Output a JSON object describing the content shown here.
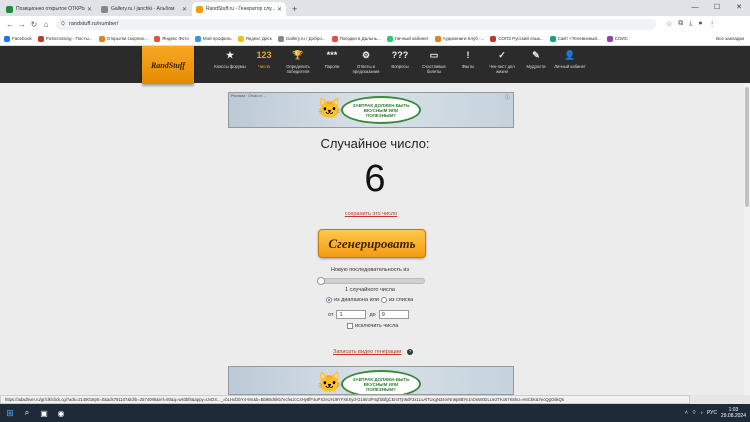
{
  "browser": {
    "tabs": [
      {
        "title": "Позиционно открытое ОТКРЫТИ",
        "color": "#1e8e3e",
        "active": false
      },
      {
        "title": "Gallery.ru / janchki - Альбом",
        "color": "#888888",
        "active": false
      },
      {
        "title": "RandStuff.ru - Генератор слу...",
        "color": "#f39c12",
        "active": true
      }
    ],
    "new_tab": "+",
    "url": "randstuff.ru/number/",
    "bookmarks": [
      {
        "label": "Facebook",
        "color": "#1877f2"
      },
      {
        "label": "Postcrossing - Посты...",
        "color": "#c0392b"
      },
      {
        "label": "Открытки скорпио...",
        "color": "#e67e22"
      },
      {
        "label": "Яндекс Фото",
        "color": "#e74c3c"
      },
      {
        "label": "Мой профиль",
        "color": "#3498db"
      },
      {
        "label": "Яндекс Диск",
        "color": "#f1c40f"
      },
      {
        "label": "Gallery.ru / Добро...",
        "color": "#888888"
      },
      {
        "label": "Поездки в Дальнь...",
        "color": "#e74c3c"
      },
      {
        "label": "Личный кабинет",
        "color": "#2ecc71"
      },
      {
        "label": "Аудиокниги Клуб -...",
        "color": "#e67e22"
      },
      {
        "label": "СОПЗ Русский язык...",
        "color": "#c0392b"
      },
      {
        "label": "Сайт «Телевизный...",
        "color": "#16a085"
      },
      {
        "label": "СОИС",
        "color": "#8e44ad"
      }
    ],
    "all_bookmarks": "Все закладки"
  },
  "site": {
    "logo": "RandStuff",
    "nav": [
      {
        "icon": "★",
        "label": "Классы форумы",
        "active": false
      },
      {
        "icon": "123",
        "label": "Числа",
        "active": true
      },
      {
        "icon": "🏆",
        "label": "Определить победителя",
        "active": false
      },
      {
        "icon": "***",
        "label": "Пароли",
        "active": false
      },
      {
        "icon": "⚙",
        "label": "Ответы и предсказания",
        "active": false
      },
      {
        "icon": "???",
        "label": "Вопросы",
        "active": false
      },
      {
        "icon": "▭",
        "label": "Счастливые билеты",
        "active": false
      },
      {
        "icon": "!",
        "label": "Факты",
        "active": false
      },
      {
        "icon": "✓",
        "label": "Чек-лист дел жизни",
        "active": false
      },
      {
        "icon": "✎",
        "label": "Мудрости",
        "active": false
      },
      {
        "icon": "👤",
        "label": "Личный кабинет",
        "active": false
      }
    ],
    "banner": {
      "ad_tag": "Реклама · Отказ от ...",
      "text": "ЗАВТРАК ДОЛЖЕН БЫТЬ ВКУСНЫМ ИЛИ ПОЛЕЗНЫМ?",
      "info_icon": "ⓘ"
    },
    "title": "Случайное число:",
    "result": "6",
    "save_link": "сохранить это число",
    "generate_button": "Сгенерировать",
    "sequence_label": "Новую последовательность из",
    "slider_value": 1,
    "count_label": "1 случайного числа",
    "radio_range": "из диапазона или",
    "radio_list": "из списка",
    "range_from_label": "от",
    "range_from": "1",
    "range_to_label": "до",
    "range_to": "9",
    "exclude_label": "исключить числа",
    "video_link": "Записать видео генерации",
    "help_icon": "?"
  },
  "status_url": "https://adadriver.ru/gr/clk/click.cgi?ads=2149018ptr=0&ads791107&tdrb=2574086&ref=80&q=ws0bf8&appy=UvDS..._=bLHxf2bY4-9m&b=Bb9Bcl6kb7ecfeLlcC4Hy8fF4uPXzeUHJ9YFX6Xyd-G16m3P4qfSBfgCEmtTjn6dF3x1LuAl7UxgN34nrNn6p8BYv1nOsW0DLUe2TKx67K8hU=HnCkK&YecQgG6kQs",
  "taskbar": {
    "time": "1:03",
    "date": "29.08.2024",
    "lang": "РУС"
  }
}
